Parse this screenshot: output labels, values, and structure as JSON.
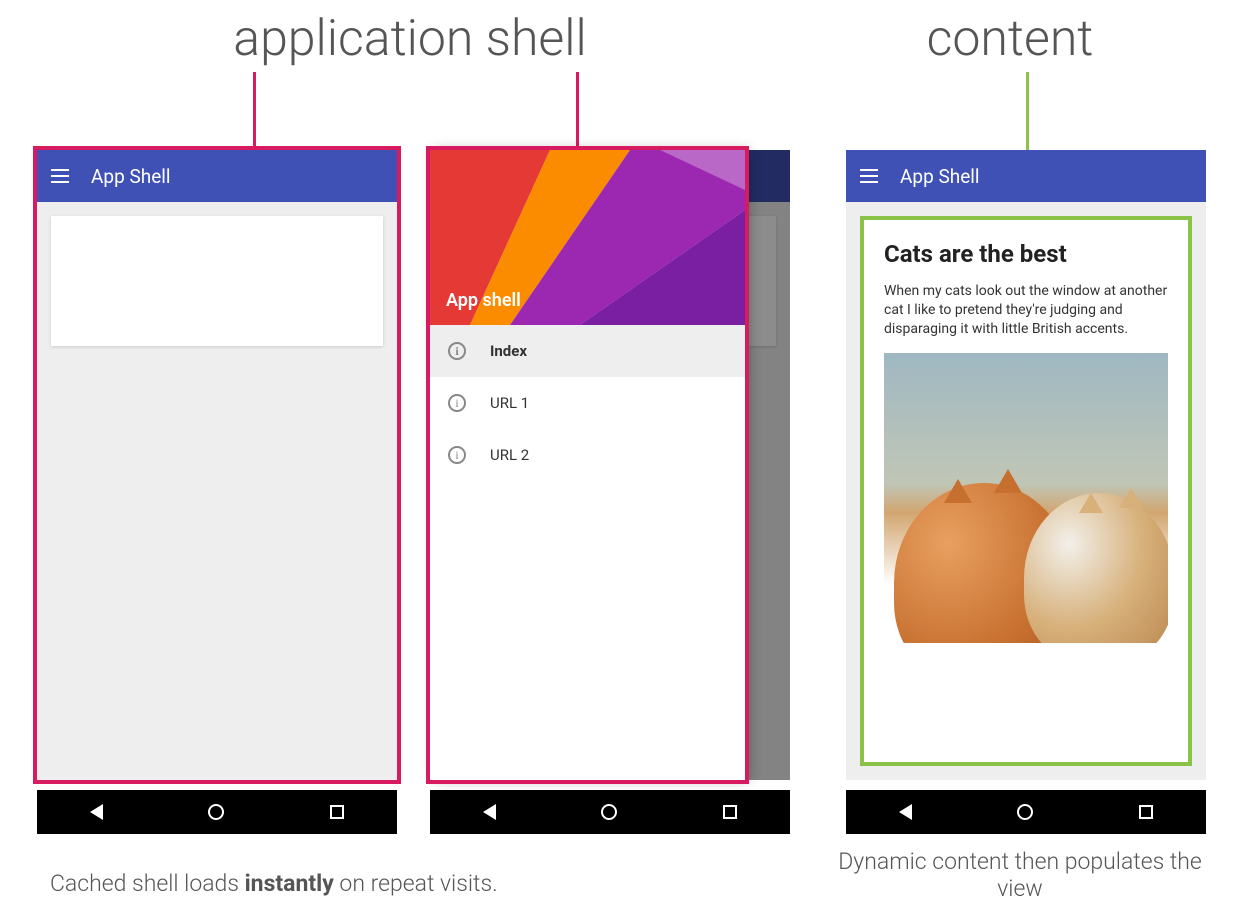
{
  "headings": {
    "left": "application shell",
    "right": "content"
  },
  "colors": {
    "shell_outline": "#D81B60",
    "content_outline": "#8BC34A",
    "appbar": "#3F51B5"
  },
  "phone1": {
    "title": "App Shell"
  },
  "phone2": {
    "drawer_title": "App shell",
    "items": [
      {
        "label": "Index",
        "active": true
      },
      {
        "label": "URL 1",
        "active": false
      },
      {
        "label": "URL 2",
        "active": false
      }
    ]
  },
  "phone3": {
    "title": "App Shell",
    "article_title": "Cats are the best",
    "article_body": "When my cats look out the window at another cat I like to pretend they're judging and disparaging it with little British accents."
  },
  "captions": {
    "left_pre": "Cached shell loads ",
    "left_bold": "instantly",
    "left_post": " on repeat visits.",
    "right": "Dynamic content then populates the view"
  }
}
